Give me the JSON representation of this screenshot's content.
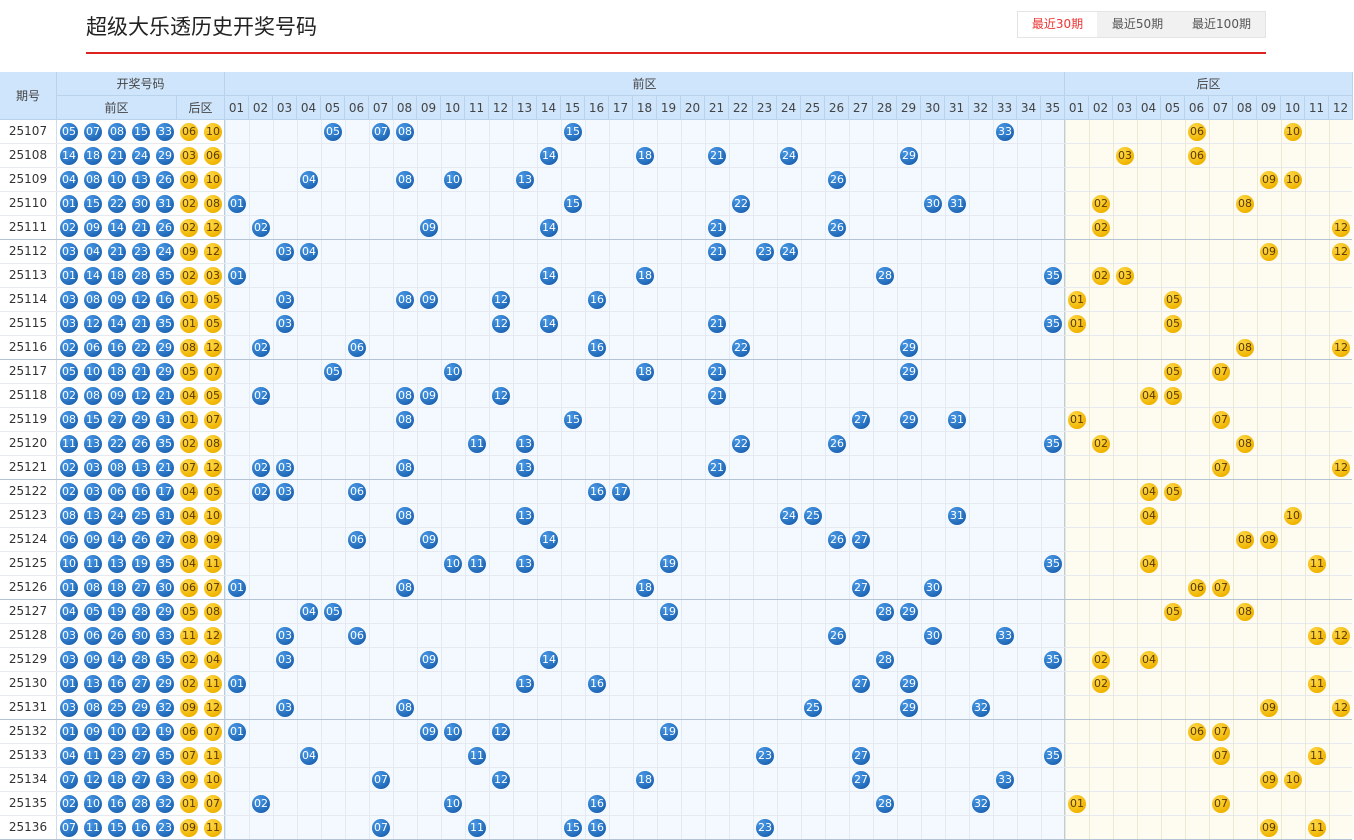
{
  "page": {
    "title": "超级大乐透历史开奖号码"
  },
  "tabs": [
    {
      "label": "最近30期",
      "active": true
    },
    {
      "label": "最近50期",
      "active": false
    },
    {
      "label": "最近100期",
      "active": false
    }
  ],
  "table": {
    "header": {
      "issue": "期号",
      "draw_group": "开奖号码",
      "draw_front": "前区",
      "draw_back": "后区",
      "front_zone": "前区",
      "back_zone": "后区"
    },
    "front_numbers": [
      "01",
      "02",
      "03",
      "04",
      "05",
      "06",
      "07",
      "08",
      "09",
      "10",
      "11",
      "12",
      "13",
      "14",
      "15",
      "16",
      "17",
      "18",
      "19",
      "20",
      "21",
      "22",
      "23",
      "24",
      "25",
      "26",
      "27",
      "28",
      "29",
      "30",
      "31",
      "32",
      "33",
      "34",
      "35"
    ],
    "back_numbers": [
      "01",
      "02",
      "03",
      "04",
      "05",
      "06",
      "07",
      "08",
      "09",
      "10",
      "11",
      "12"
    ],
    "rows": [
      {
        "issue": "25107",
        "front": [
          "05",
          "07",
          "08",
          "15",
          "33"
        ],
        "back": [
          "06",
          "10"
        ]
      },
      {
        "issue": "25108",
        "front": [
          "14",
          "18",
          "21",
          "24",
          "29"
        ],
        "back": [
          "03",
          "06"
        ]
      },
      {
        "issue": "25109",
        "front": [
          "04",
          "08",
          "10",
          "13",
          "26"
        ],
        "back": [
          "09",
          "10"
        ]
      },
      {
        "issue": "25110",
        "front": [
          "01",
          "15",
          "22",
          "30",
          "31"
        ],
        "back": [
          "02",
          "08"
        ]
      },
      {
        "issue": "25111",
        "front": [
          "02",
          "09",
          "14",
          "21",
          "26"
        ],
        "back": [
          "02",
          "12"
        ]
      },
      {
        "issue": "25112",
        "front": [
          "03",
          "04",
          "21",
          "23",
          "24"
        ],
        "back": [
          "09",
          "12"
        ]
      },
      {
        "issue": "25113",
        "front": [
          "01",
          "14",
          "18",
          "28",
          "35"
        ],
        "back": [
          "02",
          "03"
        ]
      },
      {
        "issue": "25114",
        "front": [
          "03",
          "08",
          "09",
          "12",
          "16"
        ],
        "back": [
          "01",
          "05"
        ]
      },
      {
        "issue": "25115",
        "front": [
          "03",
          "12",
          "14",
          "21",
          "35"
        ],
        "back": [
          "01",
          "05"
        ]
      },
      {
        "issue": "25116",
        "front": [
          "02",
          "06",
          "16",
          "22",
          "29"
        ],
        "back": [
          "08",
          "12"
        ]
      },
      {
        "issue": "25117",
        "front": [
          "05",
          "10",
          "18",
          "21",
          "29"
        ],
        "back": [
          "05",
          "07"
        ]
      },
      {
        "issue": "25118",
        "front": [
          "02",
          "08",
          "09",
          "12",
          "21"
        ],
        "back": [
          "04",
          "05"
        ]
      },
      {
        "issue": "25119",
        "front": [
          "08",
          "15",
          "27",
          "29",
          "31"
        ],
        "back": [
          "01",
          "07"
        ]
      },
      {
        "issue": "25120",
        "front": [
          "11",
          "13",
          "22",
          "26",
          "35"
        ],
        "back": [
          "02",
          "08"
        ]
      },
      {
        "issue": "25121",
        "front": [
          "02",
          "03",
          "08",
          "13",
          "21"
        ],
        "back": [
          "07",
          "12"
        ]
      },
      {
        "issue": "25122",
        "front": [
          "02",
          "03",
          "06",
          "16",
          "17"
        ],
        "back": [
          "04",
          "05"
        ]
      },
      {
        "issue": "25123",
        "front": [
          "08",
          "13",
          "24",
          "25",
          "31"
        ],
        "back": [
          "04",
          "10"
        ]
      },
      {
        "issue": "25124",
        "front": [
          "06",
          "09",
          "14",
          "26",
          "27"
        ],
        "back": [
          "08",
          "09"
        ]
      },
      {
        "issue": "25125",
        "front": [
          "10",
          "11",
          "13",
          "19",
          "35"
        ],
        "back": [
          "04",
          "11"
        ]
      },
      {
        "issue": "25126",
        "front": [
          "01",
          "08",
          "18",
          "27",
          "30"
        ],
        "back": [
          "06",
          "07"
        ]
      },
      {
        "issue": "25127",
        "front": [
          "04",
          "05",
          "19",
          "28",
          "29"
        ],
        "back": [
          "05",
          "08"
        ]
      },
      {
        "issue": "25128",
        "front": [
          "03",
          "06",
          "26",
          "30",
          "33"
        ],
        "back": [
          "11",
          "12"
        ]
      },
      {
        "issue": "25129",
        "front": [
          "03",
          "09",
          "14",
          "28",
          "35"
        ],
        "back": [
          "02",
          "04"
        ]
      },
      {
        "issue": "25130",
        "front": [
          "01",
          "13",
          "16",
          "27",
          "29"
        ],
        "back": [
          "02",
          "11"
        ]
      },
      {
        "issue": "25131",
        "front": [
          "03",
          "08",
          "25",
          "29",
          "32"
        ],
        "back": [
          "09",
          "12"
        ]
      },
      {
        "issue": "25132",
        "front": [
          "01",
          "09",
          "10",
          "12",
          "19"
        ],
        "back": [
          "06",
          "07"
        ]
      },
      {
        "issue": "25133",
        "front": [
          "04",
          "11",
          "23",
          "27",
          "35"
        ],
        "back": [
          "07",
          "11"
        ]
      },
      {
        "issue": "25134",
        "front": [
          "07",
          "12",
          "18",
          "27",
          "33"
        ],
        "back": [
          "09",
          "10"
        ]
      },
      {
        "issue": "25135",
        "front": [
          "02",
          "10",
          "16",
          "28",
          "32"
        ],
        "back": [
          "01",
          "07"
        ]
      },
      {
        "issue": "25136",
        "front": [
          "07",
          "11",
          "15",
          "16",
          "23"
        ],
        "back": [
          "09",
          "11"
        ]
      }
    ]
  }
}
